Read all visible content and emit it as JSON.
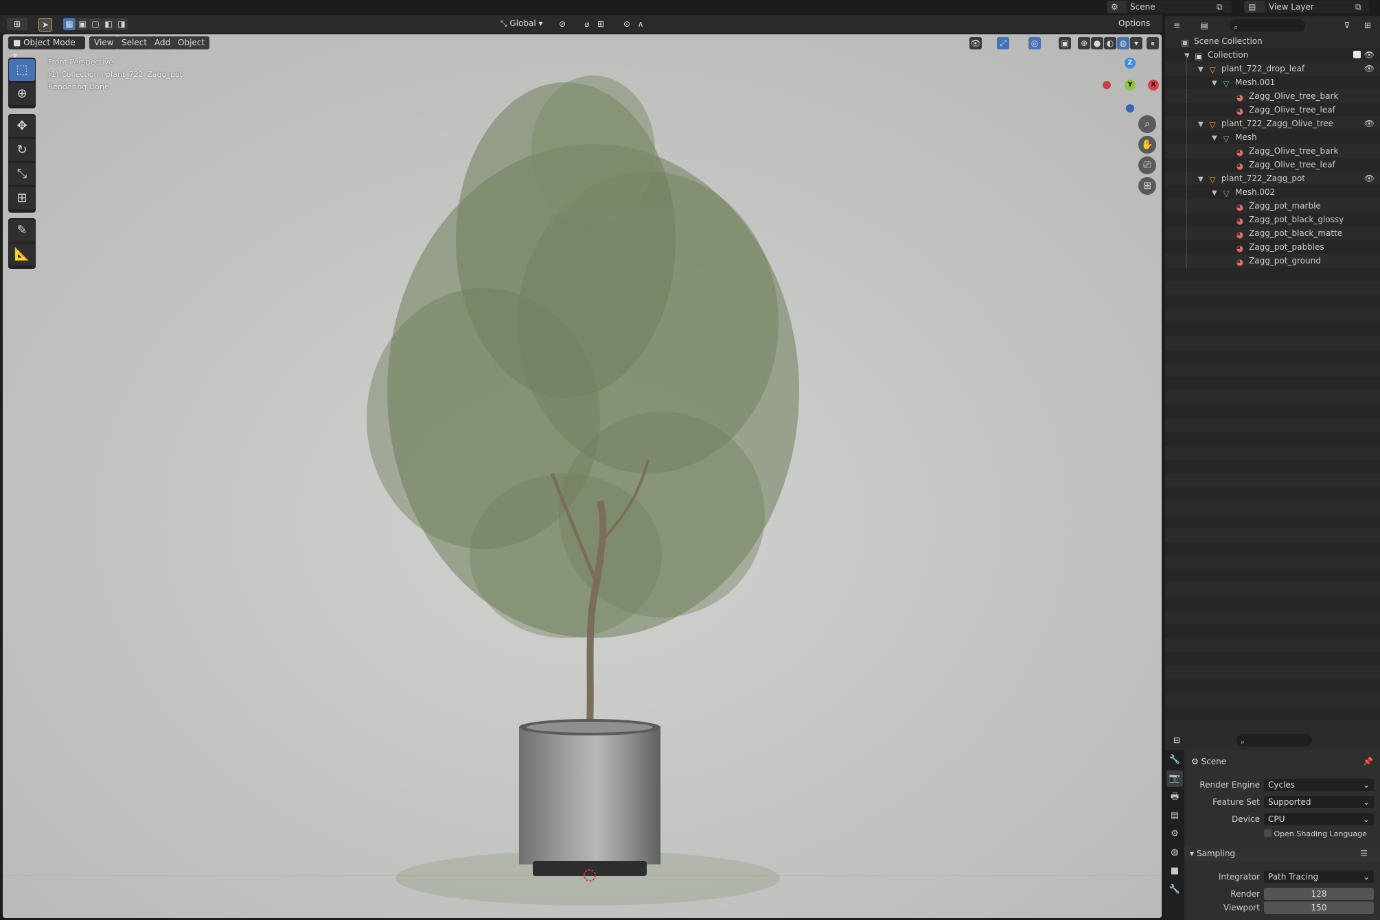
{
  "top_header": {
    "scene_name": "Scene",
    "view_layer_name": "View Layer"
  },
  "viewport_header": {
    "mode": "Object Mode",
    "menu": [
      "View",
      "Select",
      "Add",
      "Object"
    ],
    "transform_orientation": "Global",
    "options_label": "Options"
  },
  "viewport_overlay": {
    "view_name": "Front Perspective",
    "collection_info": "(1) Collection | plant_722_Zagg_pot",
    "status": "Rendering Done"
  },
  "gizmo": {
    "axes": [
      "Z",
      "Y",
      "X"
    ],
    "colors": {
      "x": "#e33c4d",
      "y": "#8dc63f",
      "z": "#3c8ce4"
    }
  },
  "tools": [
    "select-box",
    "cursor",
    "move",
    "rotate",
    "scale",
    "transform",
    "annotate",
    "measure"
  ],
  "outliner": {
    "rows": [
      {
        "label": "Scene Collection",
        "indent": 0,
        "icon": "scene-collection-icon",
        "arrow": "",
        "eye": false
      },
      {
        "label": "Collection",
        "indent": 1,
        "icon": "collection-icon",
        "arrow": "▼",
        "eye": true,
        "check": true
      },
      {
        "label": "plant_722_drop_leaf",
        "indent": 2,
        "icon": "object-icon",
        "arrow": "▼",
        "eye": true
      },
      {
        "label": "Mesh.001",
        "indent": 3,
        "icon": "mesh-icon",
        "arrow": "▼",
        "eye": false
      },
      {
        "label": "Zagg_Olive_tree_bark",
        "indent": 4,
        "icon": "material-icon",
        "arrow": "",
        "eye": false
      },
      {
        "label": "Zagg_Olive_tree_leaf",
        "indent": 4,
        "icon": "material-icon",
        "arrow": "",
        "eye": false
      },
      {
        "label": "plant_722_Zagg_Olive_tree",
        "indent": 2,
        "icon": "object-icon",
        "arrow": "▼",
        "eye": true
      },
      {
        "label": "Mesh",
        "indent": 3,
        "icon": "mesh-icon",
        "arrow": "▼",
        "eye": false
      },
      {
        "label": "Zagg_Olive_tree_bark",
        "indent": 4,
        "icon": "material-icon",
        "arrow": "",
        "eye": false
      },
      {
        "label": "Zagg_Olive_tree_leaf",
        "indent": 4,
        "icon": "material-icon",
        "arrow": "",
        "eye": false
      },
      {
        "label": "plant_722_Zagg_pot",
        "indent": 2,
        "icon": "object-icon",
        "arrow": "▼",
        "eye": true
      },
      {
        "label": "Mesh.002",
        "indent": 3,
        "icon": "mesh-icon",
        "arrow": "▼",
        "eye": false
      },
      {
        "label": "Zagg_pot_marble",
        "indent": 4,
        "icon": "material-icon",
        "arrow": "",
        "eye": false
      },
      {
        "label": "Zagg_pot_black_glossy",
        "indent": 4,
        "icon": "material-icon",
        "arrow": "",
        "eye": false
      },
      {
        "label": "Zagg_pot_black_matte",
        "indent": 4,
        "icon": "material-icon",
        "arrow": "",
        "eye": false
      },
      {
        "label": "Zagg_pot_pabbles",
        "indent": 4,
        "icon": "material-icon",
        "arrow": "",
        "eye": false
      },
      {
        "label": "Zagg_pot_ground",
        "indent": 4,
        "icon": "material-icon",
        "arrow": "",
        "eye": false
      }
    ]
  },
  "properties": {
    "context": "Scene",
    "render_engine_label": "Render Engine",
    "render_engine": "Cycles",
    "feature_set_label": "Feature Set",
    "feature_set": "Supported",
    "device_label": "Device",
    "device": "CPU",
    "osl_label": "Open Shading Language",
    "sampling_label": "Sampling",
    "integrator_label": "Integrator",
    "integrator": "Path Tracing",
    "render_label": "Render",
    "render_samples": "128",
    "viewport_label": "Viewport",
    "viewport_samples": "150"
  }
}
